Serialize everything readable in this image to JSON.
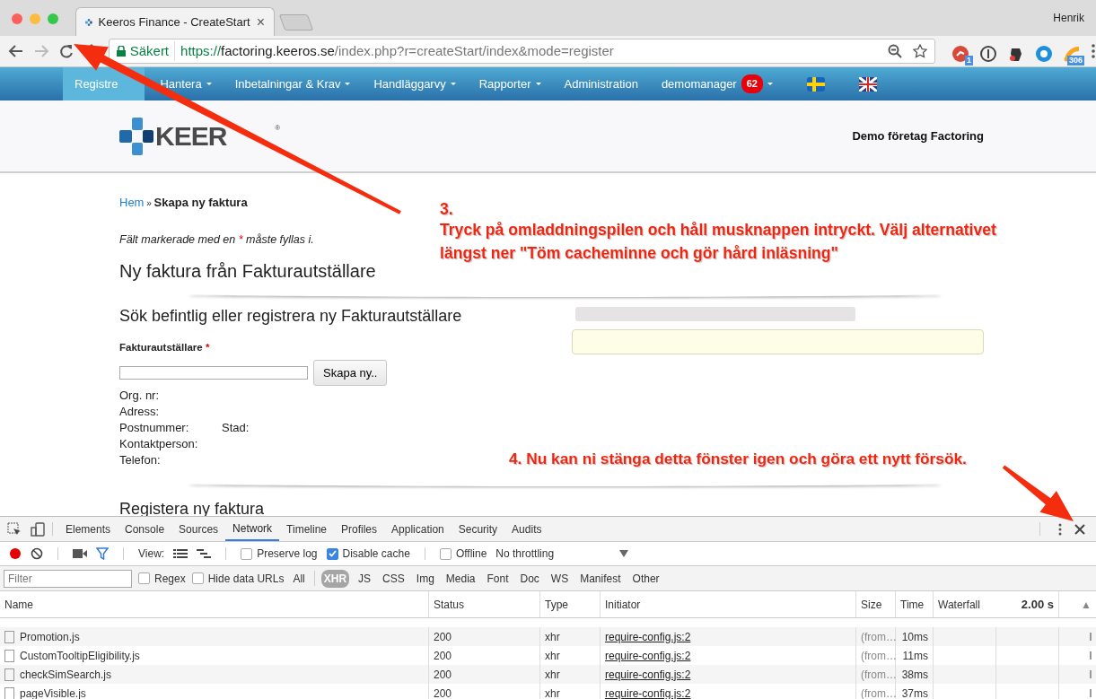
{
  "browser": {
    "tab_title": "Keeros Finance - CreateStart",
    "tab_close": "×",
    "user": "Henrik",
    "address": {
      "secure_label": "Säkert",
      "scheme": "https://",
      "host": "factoring.keeros.se",
      "path": "/index.php?r=createStart/index&mode=register"
    },
    "extension_badges": [
      "1",
      "306"
    ]
  },
  "nav": {
    "items": [
      {
        "label": "Registre",
        "dropdown": false,
        "selected": true
      },
      {
        "label": "Hantera",
        "dropdown": true,
        "selected": false
      },
      {
        "label": "Inbetalningar & Krav",
        "dropdown": true,
        "selected": false
      },
      {
        "label": "Handläggarvy",
        "dropdown": true,
        "selected": false
      },
      {
        "label": "Rapporter",
        "dropdown": true,
        "selected": false
      },
      {
        "label": "Administration",
        "dropdown": false,
        "selected": false
      },
      {
        "label": "demomanager",
        "dropdown": true,
        "selected": false,
        "badge": "62"
      }
    ]
  },
  "header": {
    "logo_text": "KEER",
    "logo_mark": "®",
    "company": "Demo företag Factoring"
  },
  "breadcrumb": {
    "home": "Hem",
    "separator": "»",
    "current": "Skapa ny faktura"
  },
  "required_note": {
    "before": "Fält markerade med en",
    "mark": "*",
    "after": "måste fyllas i."
  },
  "heading": "Ny faktura från Fakturautställare",
  "search_section": {
    "title": "Sök befintlig eller registrera ny Fakturautställare",
    "field_label": "Fakturautställare",
    "required_mark": "*",
    "create_button": "Skapa ny..",
    "info": [
      [
        "Org. nr:"
      ],
      [
        "Adress:"
      ],
      [
        "Postnummer:",
        "Stad:"
      ],
      [
        "Kontaktperson:"
      ],
      [
        "Telefon:"
      ]
    ]
  },
  "register_section": {
    "title": "Registera ny faktura"
  },
  "annotations": {
    "step3_number": "3.",
    "step3_text": "Tryck på omladdningspilen och håll musknappen intryckt. Välj alternativet längst ner \"Töm cacheminne och gör hård inläsning\"",
    "step4_text": "4. Nu kan ni stänga detta fönster igen och göra ett nytt försök."
  },
  "devtools": {
    "tabs": [
      {
        "label": "Elements",
        "selected": false
      },
      {
        "label": "Console",
        "selected": false
      },
      {
        "label": "Sources",
        "selected": false
      },
      {
        "label": "Network",
        "selected": true
      },
      {
        "label": "Timeline",
        "selected": false
      },
      {
        "label": "Profiles",
        "selected": false
      },
      {
        "label": "Application",
        "selected": false
      },
      {
        "label": "Security",
        "selected": false
      },
      {
        "label": "Audits",
        "selected": false
      }
    ],
    "toolbar": {
      "view_label": "View:",
      "options": [
        {
          "label": "Preserve log",
          "checked": false
        },
        {
          "label": "Disable cache",
          "checked": true
        },
        {
          "label": "Offline",
          "checked": false
        }
      ],
      "throttling": "No throttling"
    },
    "filter": {
      "placeholder": "Filter",
      "options": [
        {
          "label": "Regex",
          "checked": false
        },
        {
          "label": "Hide data URLs",
          "checked": false
        }
      ],
      "types": [
        {
          "label": "All",
          "selected": false
        },
        {
          "label": "XHR",
          "selected": true
        },
        {
          "label": "JS",
          "selected": false
        },
        {
          "label": "CSS",
          "selected": false
        },
        {
          "label": "Img",
          "selected": false
        },
        {
          "label": "Media",
          "selected": false
        },
        {
          "label": "Font",
          "selected": false
        },
        {
          "label": "Doc",
          "selected": false
        },
        {
          "label": "WS",
          "selected": false
        },
        {
          "label": "Manifest",
          "selected": false
        },
        {
          "label": "Other",
          "selected": false
        }
      ]
    },
    "table": {
      "columns": [
        "Name",
        "Status",
        "Type",
        "Initiator",
        "Size",
        "Time",
        "Waterfall"
      ],
      "waterfall_scale": "2.00 s",
      "sort_mark": "▲",
      "rows": [
        {
          "name": "Promotion.js",
          "status": "200",
          "type": "xhr",
          "initiator": "require-config.js:2",
          "size": "(from…",
          "time": "10ms"
        },
        {
          "name": "CustomTooltipEligibility.js",
          "status": "200",
          "type": "xhr",
          "initiator": "require-config.js:2",
          "size": "(from…",
          "time": "11ms"
        },
        {
          "name": "checkSimSearch.js",
          "status": "200",
          "type": "xhr",
          "initiator": "require-config.js:2",
          "size": "(from…",
          "time": "38ms"
        },
        {
          "name": "pageVisible.js",
          "status": "200",
          "type": "xhr",
          "initiator": "require-config.js:2",
          "size": "(from…",
          "time": "37ms"
        }
      ]
    }
  }
}
